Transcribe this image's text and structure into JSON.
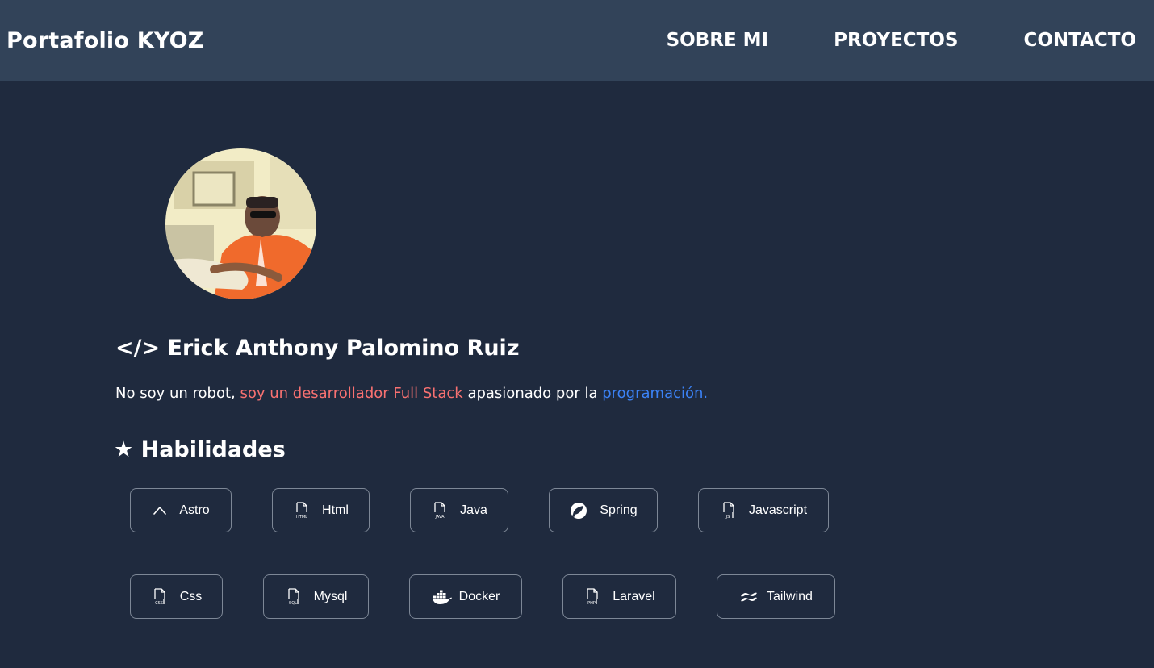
{
  "header": {
    "brand": "Portafolio KYOZ",
    "nav": [
      {
        "label": "SOBRE MI"
      },
      {
        "label": "PROYECTOS"
      },
      {
        "label": "CONTACTO"
      }
    ]
  },
  "profile": {
    "name_heading": "</> Erick Anthony Palomino Ruiz",
    "intro": {
      "part1": "No soy un robot, ",
      "part2": "soy un desarrollador Full Stack",
      "part3": " apasionado por la ",
      "part4": "programación."
    }
  },
  "skills": {
    "heading": "★ Habilidades",
    "items": [
      {
        "label": "Astro",
        "icon": "astro-icon"
      },
      {
        "label": "Html",
        "icon": "html-file-icon",
        "icon_text": "HTML"
      },
      {
        "label": "Java",
        "icon": "java-file-icon",
        "icon_text": "JAVA"
      },
      {
        "label": "Spring",
        "icon": "spring-icon"
      },
      {
        "label": "Javascript",
        "icon": "js-file-icon",
        "icon_text": "JS"
      },
      {
        "label": "Css",
        "icon": "css-file-icon",
        "icon_text": "CSS"
      },
      {
        "label": "Mysql",
        "icon": "sql-file-icon",
        "icon_text": "SQL"
      },
      {
        "label": "Docker",
        "icon": "docker-icon"
      },
      {
        "label": "Laravel",
        "icon": "php-file-icon",
        "icon_text": "PHP"
      },
      {
        "label": "Tailwind",
        "icon": "tailwind-icon"
      }
    ]
  },
  "colors": {
    "background": "#1f2a3e",
    "navbar": "#324359",
    "accent_red": "#f87171",
    "accent_blue": "#3b82f6",
    "border": "#7d8796"
  }
}
